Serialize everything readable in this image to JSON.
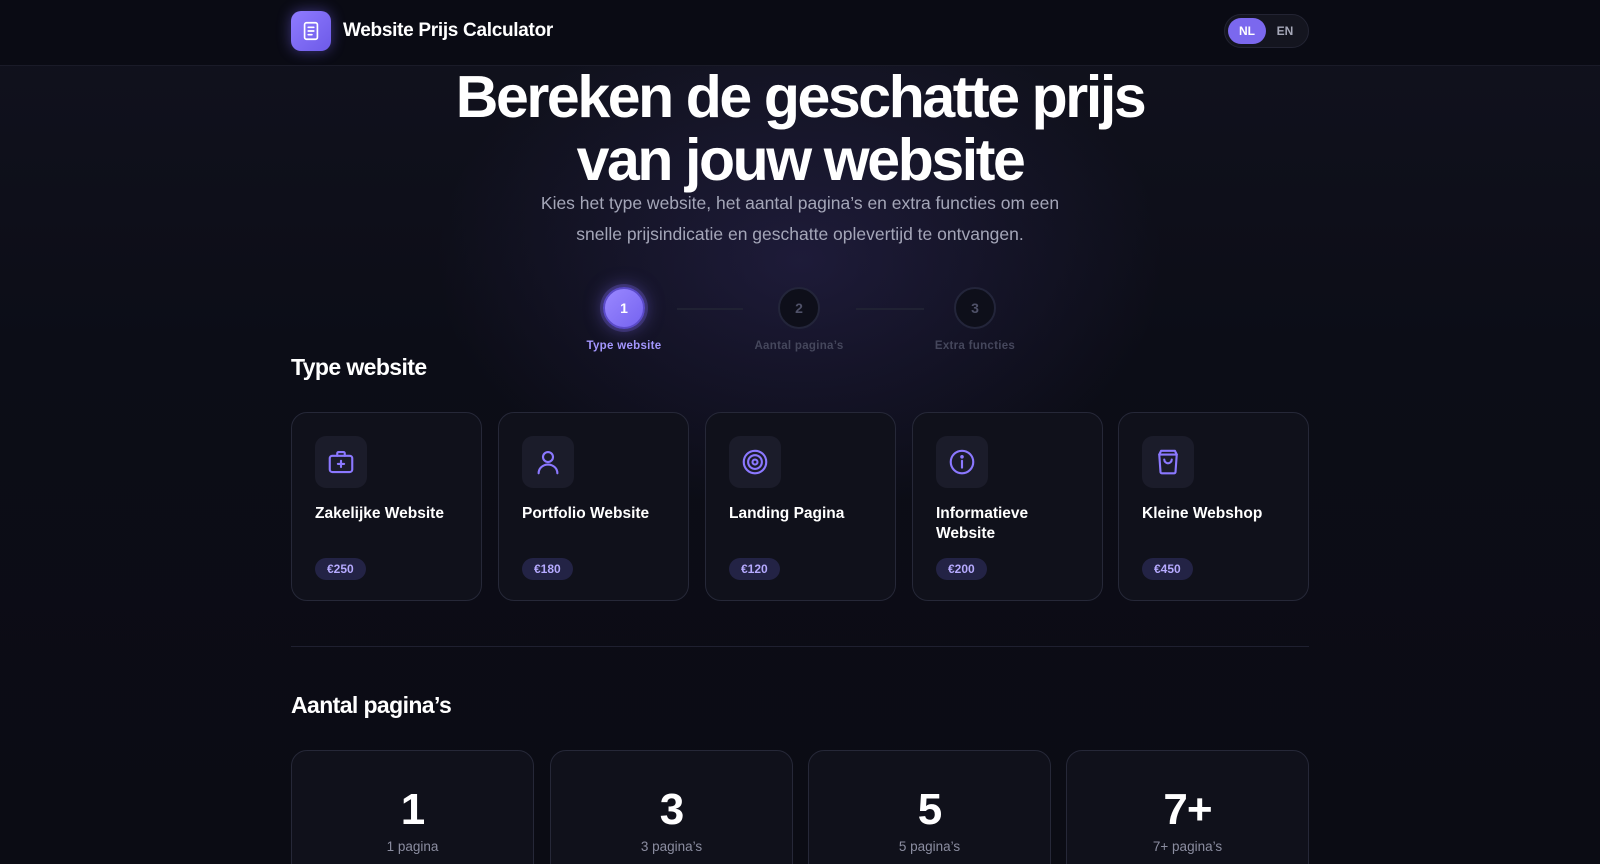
{
  "header": {
    "title": "Website Prijs Calculator",
    "logo_icon": "document-icon",
    "languages": [
      {
        "code": "NL",
        "active": true
      },
      {
        "code": "EN",
        "active": false
      }
    ]
  },
  "hero": {
    "title_line1": "Bereken de geschatte prijs",
    "title_line2": "van jouw website",
    "subtitle_line1": "Kies het type website, het aantal pagina’s en extra functies om een",
    "subtitle_line2": "snelle prijsindicatie en geschatte oplevertijd te ontvangen."
  },
  "stepper": {
    "steps": [
      {
        "number": "1",
        "label": "Type website",
        "active": true
      },
      {
        "number": "2",
        "label": "Aantal pagina’s",
        "active": false
      },
      {
        "number": "3",
        "label": "Extra functies",
        "active": false
      }
    ]
  },
  "type_section": {
    "title": "Type website",
    "options": [
      {
        "title": "Zakelijke Website",
        "price": "€250",
        "icon": "briefcase-icon"
      },
      {
        "title": "Portfolio Website",
        "price": "€180",
        "icon": "user-icon"
      },
      {
        "title": "Landing Pagina",
        "price": "€120",
        "icon": "target-icon"
      },
      {
        "title": "Informatieve Website",
        "price": "€200",
        "icon": "info-icon"
      },
      {
        "title": "Kleine Webshop",
        "price": "€450",
        "icon": "shopping-bag-icon"
      }
    ]
  },
  "pages_section": {
    "title": "Aantal pagina’s",
    "options": [
      {
        "number": "1",
        "label": "1 pagina"
      },
      {
        "number": "3",
        "label": "3 pagina’s"
      },
      {
        "number": "5",
        "label": "5 pagina’s"
      },
      {
        "number": "7+",
        "label": "7+ pagina’s"
      }
    ]
  },
  "colors": {
    "accent": "#7b68ee",
    "background": "#0b0c14",
    "card": "#10111b",
    "price_badge_bg": "#232345",
    "price_badge_text": "#b6aaff"
  }
}
